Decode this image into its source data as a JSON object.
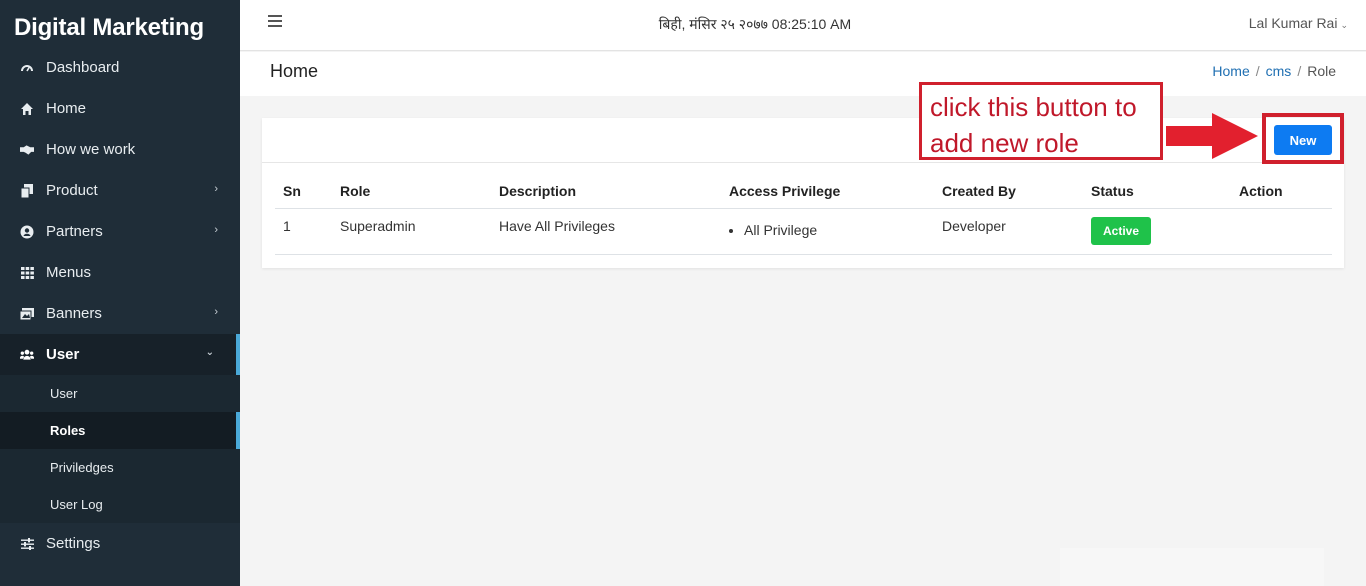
{
  "app": {
    "brand": "Digital Marketing"
  },
  "sidebar": {
    "items": [
      {
        "label": "Dashboard",
        "icon": "gauge-icon"
      },
      {
        "label": "Home",
        "icon": "home-icon"
      },
      {
        "label": "How we work",
        "icon": "handshake-icon"
      },
      {
        "label": "Product",
        "icon": "copy-icon",
        "has_children": true
      },
      {
        "label": "Partners",
        "icon": "user-circle-icon",
        "has_children": true
      },
      {
        "label": "Menus",
        "icon": "grid-icon"
      },
      {
        "label": "Banners",
        "icon": "images-icon",
        "has_children": true
      },
      {
        "label": "User",
        "icon": "users-icon",
        "expanded": true
      },
      {
        "label": "Settings",
        "icon": "sliders-icon"
      }
    ],
    "user_submenu": [
      {
        "label": "User"
      },
      {
        "label": "Roles",
        "active": true
      },
      {
        "label": "Priviledges"
      },
      {
        "label": "User Log"
      }
    ]
  },
  "topbar": {
    "datetime": "बिही, मंसिर २५ २०७७ 08:25:10 AM",
    "user_name": "Lal Kumar Rai"
  },
  "page": {
    "title": "Home",
    "breadcrumb": [
      "Home",
      "cms",
      "Role"
    ]
  },
  "toolbar": {
    "new_label": "New"
  },
  "table": {
    "headers": [
      "Sn",
      "Role",
      "Description",
      "Access Privilege",
      "Created By",
      "Status",
      "Action"
    ],
    "rows": [
      {
        "sn": "1",
        "role": "Superadmin",
        "description": "Have All Privileges",
        "privileges": [
          "All Privilege"
        ],
        "created_by": "Developer",
        "status": "Active"
      }
    ]
  },
  "annotation": {
    "line1": "click this button to",
    "line2": "add new role"
  },
  "colors": {
    "sidebar_bg": "#1f2d38",
    "accent": "#4aa9d8",
    "primary_button": "#0d7bf2",
    "status_active": "#1fc24a",
    "annotation": "#d0202d"
  }
}
